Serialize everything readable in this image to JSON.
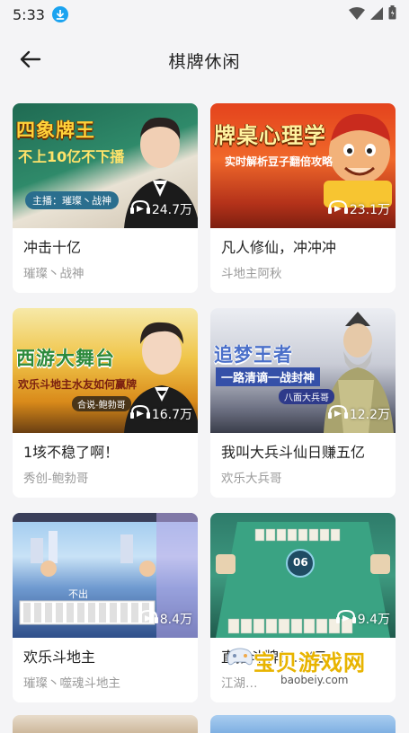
{
  "status_bar": {
    "time": "5:33",
    "icons": [
      "download-icon",
      "wifi-icon",
      "signal-icon",
      "battery-icon"
    ]
  },
  "header": {
    "title": "棋牌休闲",
    "back_icon": "arrow-left-icon"
  },
  "cards": [
    {
      "title": "冲击十亿",
      "author": "璀璨丶战神",
      "plays": "24.7万",
      "thumb_title": "四象牌王",
      "thumb_sub": "不上10亿不下播",
      "thumb_tag": "主播：璀璨丶战神"
    },
    {
      "title": "凡人修仙，冲冲冲",
      "author": "斗地主阿秋",
      "plays": "23.1万",
      "thumb_title": "牌桌心理学",
      "thumb_sub": "实时解析豆子翻倍攻略"
    },
    {
      "title": "1垓不稳了啊！",
      "author": "秀创-鲍勃哥",
      "plays": "16.7万",
      "thumb_title": "西游大舞台",
      "thumb_sub": "欢乐斗地主水友如何赢牌",
      "thumb_tag": "合说-鲍勃哥"
    },
    {
      "title": "我叫大兵斗仙日赚五亿",
      "author": "欢乐大兵哥",
      "plays": "12.2万",
      "thumb_title": "追梦王者",
      "thumb_sub": "一路清谪一战封神",
      "thumb_tag": "八面大兵哥"
    },
    {
      "title": "欢乐斗地主",
      "author": "璀璨丶噬魂斗地主",
      "plays": "8.4万",
      "thumb_center": "不出"
    },
    {
      "title": "直播斗牌！…/三…",
      "author": "江湖…",
      "plays": "9.4万",
      "thumb_center": "06"
    }
  ],
  "watermark": {
    "text": "宝贝游戏网",
    "url": "baobeiy.com"
  },
  "colors": {
    "background": "#f4f4f6",
    "card": "#ffffff",
    "title": "#222222",
    "author": "#9a9a9a",
    "accent": "#1aa3f0"
  }
}
